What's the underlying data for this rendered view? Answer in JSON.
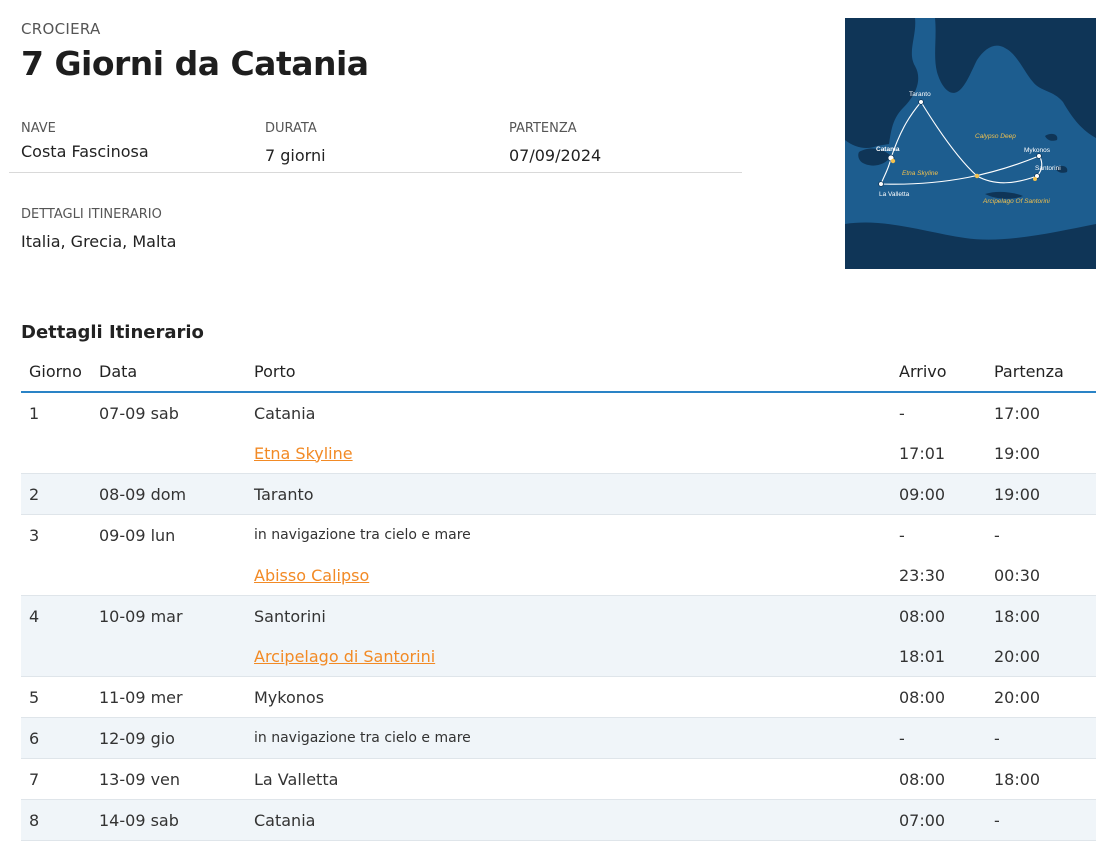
{
  "header": {
    "kicker": "CROCIERA",
    "title": "7 Giorni da Catania"
  },
  "meta": {
    "ship_label": "NAVE",
    "ship_value": "Costa Fascinosa",
    "duration_label": "DURATA",
    "duration_value": "7 giorni",
    "departure_label": "PARTENZA",
    "departure_value": "07/09/2024"
  },
  "details": {
    "label": "DETTAGLI ITINERARIO",
    "value": "Italia, Grecia, Malta"
  },
  "map": {
    "labels": {
      "taranto": "Taranto",
      "catania": "Catania",
      "etna": "Etna Skyline",
      "valletta": "La Valletta",
      "calypso": "Calypso Deep",
      "mykonos": "Mykonos",
      "santorini": "Santorini",
      "arcipelago": "Arcipelago Of Santorini"
    },
    "colors": {
      "sea": "#1d5d8f",
      "land": "#0f3557",
      "route": "#ffffff",
      "poi": "#f2c14e"
    }
  },
  "itinerary": {
    "section_title": "Dettagli Itinerario",
    "columns": {
      "day": "Giorno",
      "date": "Data",
      "port": "Porto",
      "arrival": "Arrivo",
      "departure": "Partenza"
    },
    "rows": [
      {
        "day": "1",
        "date": "07-09 sab",
        "port": "Catania",
        "kind": "port",
        "arrival": "-",
        "departure": "17:00"
      },
      {
        "day": "",
        "date": "",
        "port": "Etna Skyline",
        "kind": "link",
        "arrival": "17:01",
        "departure": "19:00"
      },
      {
        "day": "2",
        "date": "08-09 dom",
        "port": "Taranto",
        "kind": "port",
        "arrival": "09:00",
        "departure": "19:00"
      },
      {
        "day": "3",
        "date": "09-09 lun",
        "port": "in navigazione tra cielo e mare",
        "kind": "nav",
        "arrival": "-",
        "departure": "-"
      },
      {
        "day": "",
        "date": "",
        "port": "Abisso Calipso",
        "kind": "link",
        "arrival": "23:30",
        "departure": "00:30"
      },
      {
        "day": "4",
        "date": "10-09 mar",
        "port": "Santorini",
        "kind": "port",
        "arrival": "08:00",
        "departure": "18:00"
      },
      {
        "day": "",
        "date": "",
        "port": "Arcipelago di Santorini",
        "kind": "link",
        "arrival": "18:01",
        "departure": "20:00"
      },
      {
        "day": "5",
        "date": "11-09 mer",
        "port": "Mykonos",
        "kind": "port",
        "arrival": "08:00",
        "departure": "20:00"
      },
      {
        "day": "6",
        "date": "12-09 gio",
        "port": "in navigazione tra cielo e mare",
        "kind": "nav",
        "arrival": "-",
        "departure": "-"
      },
      {
        "day": "7",
        "date": "13-09 ven",
        "port": "La Valletta",
        "kind": "port",
        "arrival": "08:00",
        "departure": "18:00"
      },
      {
        "day": "8",
        "date": "14-09 sab",
        "port": "Catania",
        "kind": "port",
        "arrival": "07:00",
        "departure": "-"
      }
    ]
  }
}
